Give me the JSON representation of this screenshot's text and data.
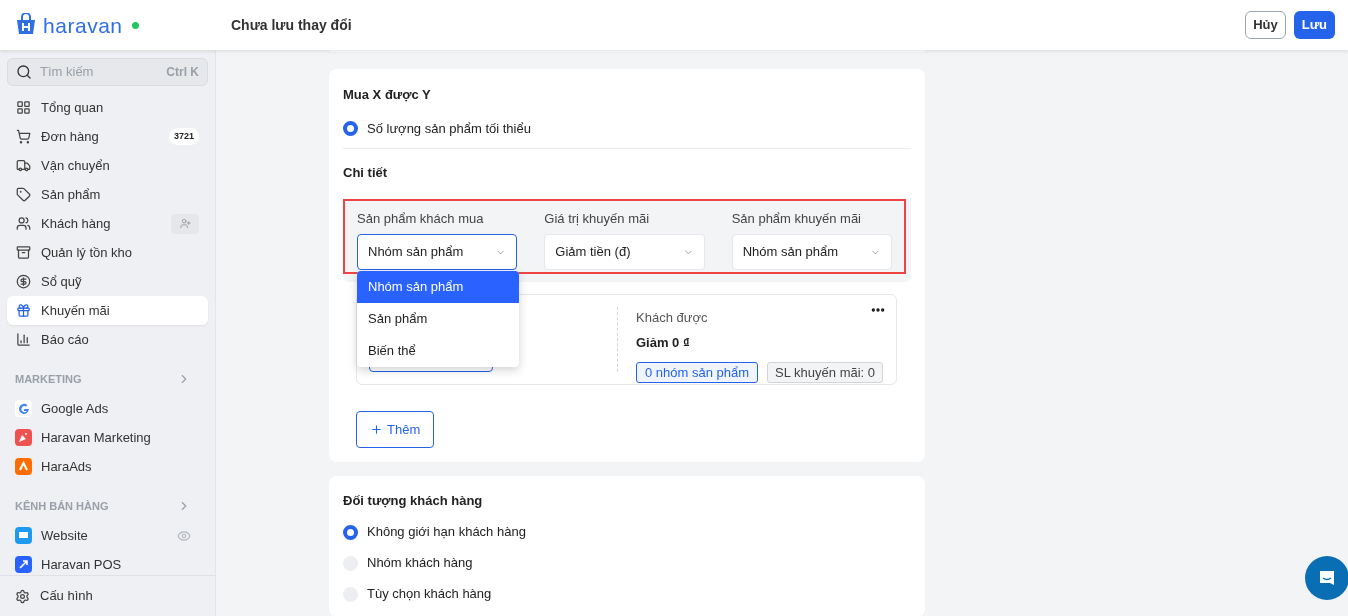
{
  "header": {
    "logo": "haravan",
    "online": true,
    "title": "Chưa lưu thay đổi",
    "buttons": [
      {
        "label": "Hủy",
        "kind": "secondary"
      },
      {
        "label": "Lưu",
        "kind": "primary"
      }
    ]
  },
  "sidebar": {
    "search": {
      "placeholder": "Tìm kiếm",
      "shortcut": "Ctrl K"
    },
    "items": [
      {
        "label": "Tổng quan",
        "kind": "grid",
        "selected": false
      },
      {
        "label": "Đơn hàng",
        "kind": "cart",
        "badge": "3721",
        "selected": false
      },
      {
        "label": "Vận chuyển",
        "kind": "truck",
        "selected": false
      },
      {
        "label": "Sản phẩm",
        "kind": "tag",
        "selected": false
      },
      {
        "label": "Khách hàng",
        "kind": "users",
        "selected": false
      },
      {
        "label": "Quản lý tồn kho",
        "kind": "archive",
        "selected": false
      },
      {
        "label": "Sổ quỹ",
        "kind": "dollar",
        "selected": false
      },
      {
        "label": "Khuyến mãi",
        "kind": "gift",
        "selected": true
      },
      {
        "label": "Báo cáo",
        "kind": "chart",
        "selected": false
      }
    ],
    "sections": [
      {
        "title": "MARKETING",
        "items": [
          {
            "label": "Google Ads",
            "kind": "google"
          },
          {
            "label": "Haravan Marketing",
            "kind": "marketing"
          },
          {
            "label": "HaraAds",
            "kind": "haraads"
          }
        ]
      },
      {
        "title": "KÊNH BÁN HÀNG",
        "items": [
          {
            "label": "Website",
            "kind": "website"
          },
          {
            "label": "Haravan POS",
            "kind": "pos"
          }
        ]
      }
    ],
    "footer": {
      "label": "Cấu hình"
    }
  },
  "promotion": {
    "title": "Mua X được Y",
    "option": {
      "label": "Số lượng sản phẩm tối thiểu",
      "selected": true
    },
    "detail_title": "Chi tiết",
    "selects": [
      {
        "label": "Sản phẩm khách mua",
        "value": "Nhóm sản phẩm",
        "open": true
      },
      {
        "label": "Giá trị khuyến mãi",
        "value": "Giảm tiền (đ)",
        "open": false
      },
      {
        "label": "Sản phẩm khuyến mãi",
        "value": "Nhóm sản phẩm",
        "open": false
      }
    ],
    "dropdown": [
      {
        "label": "Nhóm sản phẩm",
        "selected": true
      },
      {
        "label": "Sản phẩm",
        "selected": false
      },
      {
        "label": "Biến thể",
        "selected": false
      }
    ],
    "rule": {
      "heading": "Khách được",
      "value": "Giảm 0 ₫",
      "tags": [
        {
          "label": "0 nhóm sản phẩm",
          "kind": "link"
        },
        {
          "label": "SL khuyến mãi: 0",
          "kind": "plain"
        }
      ]
    },
    "add_button": "Thêm"
  },
  "customers": {
    "title": "Đối tượng khách hàng",
    "options": [
      {
        "label": "Không giới hạn khách hàng",
        "selected": true
      },
      {
        "label": "Nhóm khách hàng",
        "selected": false
      },
      {
        "label": "Tùy chọn khách hàng",
        "selected": false
      }
    ]
  }
}
